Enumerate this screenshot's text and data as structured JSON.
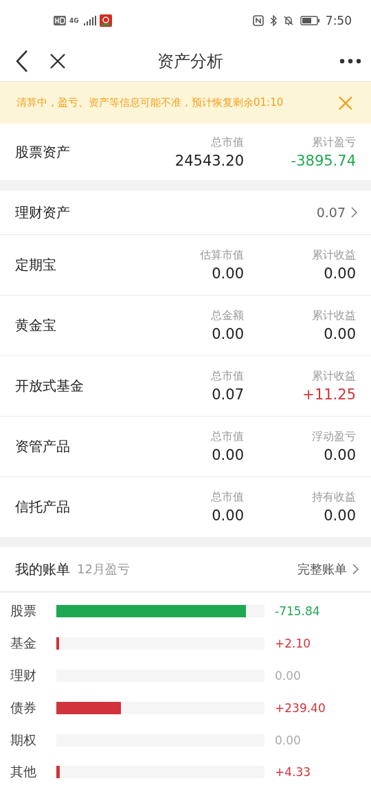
{
  "status_bar": {
    "time": "7:50",
    "network": "4G"
  },
  "nav": {
    "title": "资产分析"
  },
  "notice": {
    "text": "清算中，盈亏、资产等信息可能不准，预计恢复剩余01:10"
  },
  "stock_assets": {
    "title": "总市值",
    "label": "股票资产",
    "value": "24543.20",
    "pnl_label": "累计盈亏",
    "pnl": "-3895.74",
    "color": "#1fa852"
  },
  "wealth": {
    "title": "理财资产",
    "total": "0.07",
    "rows": [
      {
        "name": "定期宝",
        "label_1": "估算市值",
        "value_1": "0.00",
        "label_2": "累计收益",
        "value_2": "0.00",
        "color": "#222222"
      },
      {
        "name": "黄金宝",
        "label_1": "总金额",
        "value_1": "0.00",
        "label_2": "累计收益",
        "value_2": "0.00",
        "color": "#222222"
      },
      {
        "name": "开放式基金",
        "label_1": "总市值",
        "value_1": "0.07",
        "label_2": "累计收益",
        "value_2": "+11.25",
        "color": "#d0333a"
      },
      {
        "name": "资管产品",
        "label_1": "总市值",
        "value_1": "0.00",
        "label_2": "浮动盈亏",
        "value_2": "0.00",
        "color": "#222222"
      },
      {
        "name": "信托产品",
        "label_1": "总市值",
        "value_1": "0.00",
        "label_2": "持有收益",
        "value_2": "0.00",
        "color": "#222222"
      }
    ]
  },
  "bill": {
    "title": "我的账单",
    "subtitle": "12月盈亏",
    "link": "完整账单",
    "rows": [
      {
        "name": "股票",
        "level": 0.91,
        "value": "-715.84",
        "color": "#1fa852"
      },
      {
        "name": "基金",
        "level": 0.012,
        "value": "+2.10",
        "color": "#d0333a"
      },
      {
        "name": "理财",
        "value": "0.00",
        "color": "#aaaaaa"
      },
      {
        "name": "债券",
        "level": 0.31,
        "value": "+239.40",
        "color": "#d0333a"
      },
      {
        "name": "期权",
        "value": "0.00",
        "color": "#aaaaaa"
      },
      {
        "name": "其他",
        "level": 0.015,
        "value": "+4.33",
        "color": "#d0333a"
      }
    ]
  }
}
